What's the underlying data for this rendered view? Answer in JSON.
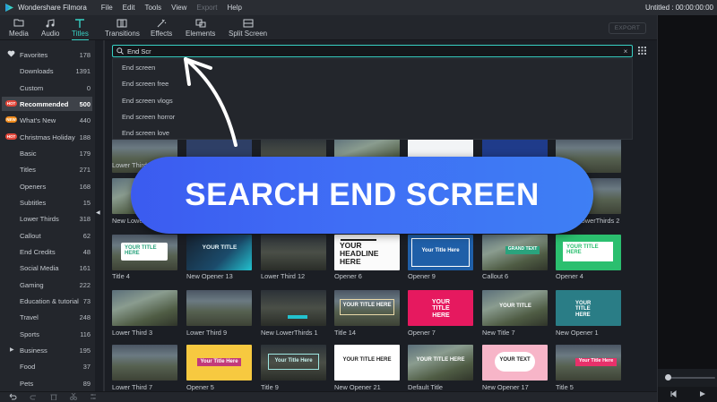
{
  "app": {
    "name": "Wondershare Filmora",
    "project_title": "Untitled : 00:00:00:00"
  },
  "menu": [
    "File",
    "Edit",
    "Tools",
    "View",
    "Export",
    "Help"
  ],
  "toolbar": {
    "tabs": [
      {
        "label": "Media",
        "icon": "folder-icon"
      },
      {
        "label": "Audio",
        "icon": "music-note-icon"
      },
      {
        "label": "Titles",
        "icon": "text-icon",
        "active": true
      },
      {
        "label": "Transitions",
        "icon": "transition-icon"
      },
      {
        "label": "Effects",
        "icon": "effects-icon"
      },
      {
        "label": "Elements",
        "icon": "elements-icon"
      },
      {
        "label": "Split Screen",
        "icon": "split-screen-icon"
      }
    ],
    "export_label": "EXPORT"
  },
  "sidebar": {
    "items": [
      {
        "label": "Favorites",
        "count": "178",
        "badge": "heart"
      },
      {
        "label": "Downloads",
        "count": "1391"
      },
      {
        "label": "Custom",
        "count": "0"
      },
      {
        "label": "Recommended",
        "count": "500",
        "badge": "HOT",
        "active": true
      },
      {
        "label": "What's New",
        "count": "440",
        "badge": "NEW"
      },
      {
        "label": "Christmas Holiday",
        "count": "188",
        "badge": "HOT"
      },
      {
        "label": "Basic",
        "count": "179"
      },
      {
        "label": "Titles",
        "count": "271"
      },
      {
        "label": "Openers",
        "count": "168"
      },
      {
        "label": "Subtitles",
        "count": "15"
      },
      {
        "label": "Lower Thirds",
        "count": "318"
      },
      {
        "label": "Callout",
        "count": "62"
      },
      {
        "label": "End Credits",
        "count": "48"
      },
      {
        "label": "Social Media",
        "count": "161"
      },
      {
        "label": "Gaming",
        "count": "222"
      },
      {
        "label": "Education & tutorial",
        "count": "73"
      },
      {
        "label": "Travel",
        "count": "248"
      },
      {
        "label": "Sports",
        "count": "116"
      },
      {
        "label": "Business",
        "count": "195",
        "expandable": true
      },
      {
        "label": "Food",
        "count": "37"
      },
      {
        "label": "Pets",
        "count": "89"
      }
    ]
  },
  "search": {
    "value": "End Scr",
    "suggestions": [
      "End screen",
      "End screen free",
      "End screen vlogs",
      "End screen horror",
      "End screen love"
    ]
  },
  "banner": {
    "text": "SEARCH END SCREEN"
  },
  "thumbnails": {
    "row1_labels": [
      "Lower Third 3",
      "",
      "",
      "",
      "",
      "",
      ""
    ],
    "row2_labels": [
      "New Lower",
      "",
      "",
      "",
      "",
      "",
      "lowerThirds 2"
    ],
    "row3": [
      {
        "label": "Title 4",
        "text": "YOUR TITLE HERE"
      },
      {
        "label": "New Opener 13",
        "text": "YOUR TITLE"
      },
      {
        "label": "Lower Third 12",
        "text": ""
      },
      {
        "label": "Opener 6",
        "text": "YOUR HEADLINE HERE"
      },
      {
        "label": "Opener 9",
        "text": "Your Title Here"
      },
      {
        "label": "Callout 6",
        "text": "GRAND TEXT"
      },
      {
        "label": "Opener 4",
        "text": "YOUR TITLE HERE"
      }
    ],
    "row4": [
      {
        "label": "Lower Third 3",
        "text": ""
      },
      {
        "label": "Lower Third 9",
        "text": ""
      },
      {
        "label": "New LowerThirds 1",
        "text": ""
      },
      {
        "label": "Title 14",
        "text": "YOUR TITLE HERE"
      },
      {
        "label": "Opener 7",
        "text": "YOUR TITLE HERE"
      },
      {
        "label": "New Title 7",
        "text": "YOUR TITLE"
      },
      {
        "label": "New Opener 1",
        "text": "YOUR TITLE HERE"
      }
    ],
    "row5": [
      {
        "label": "Lower Third 7",
        "text": ""
      },
      {
        "label": "Opener 5",
        "text": "Your Title Here"
      },
      {
        "label": "Title 9",
        "text": "Your Title Here"
      },
      {
        "label": "New Opener 21",
        "text": "YOUR TITLE HERE"
      },
      {
        "label": "Default Title",
        "text": "YOUR TITLE HERE"
      },
      {
        "label": "New Opener 17",
        "text": "YOUR TEXT"
      },
      {
        "label": "Title 5",
        "text": "Your Title Here"
      }
    ]
  },
  "colors": {
    "accent": "#38d0c4",
    "banner": "#3f6df5",
    "hot": "#e2463a",
    "new": "#f08b1c"
  }
}
